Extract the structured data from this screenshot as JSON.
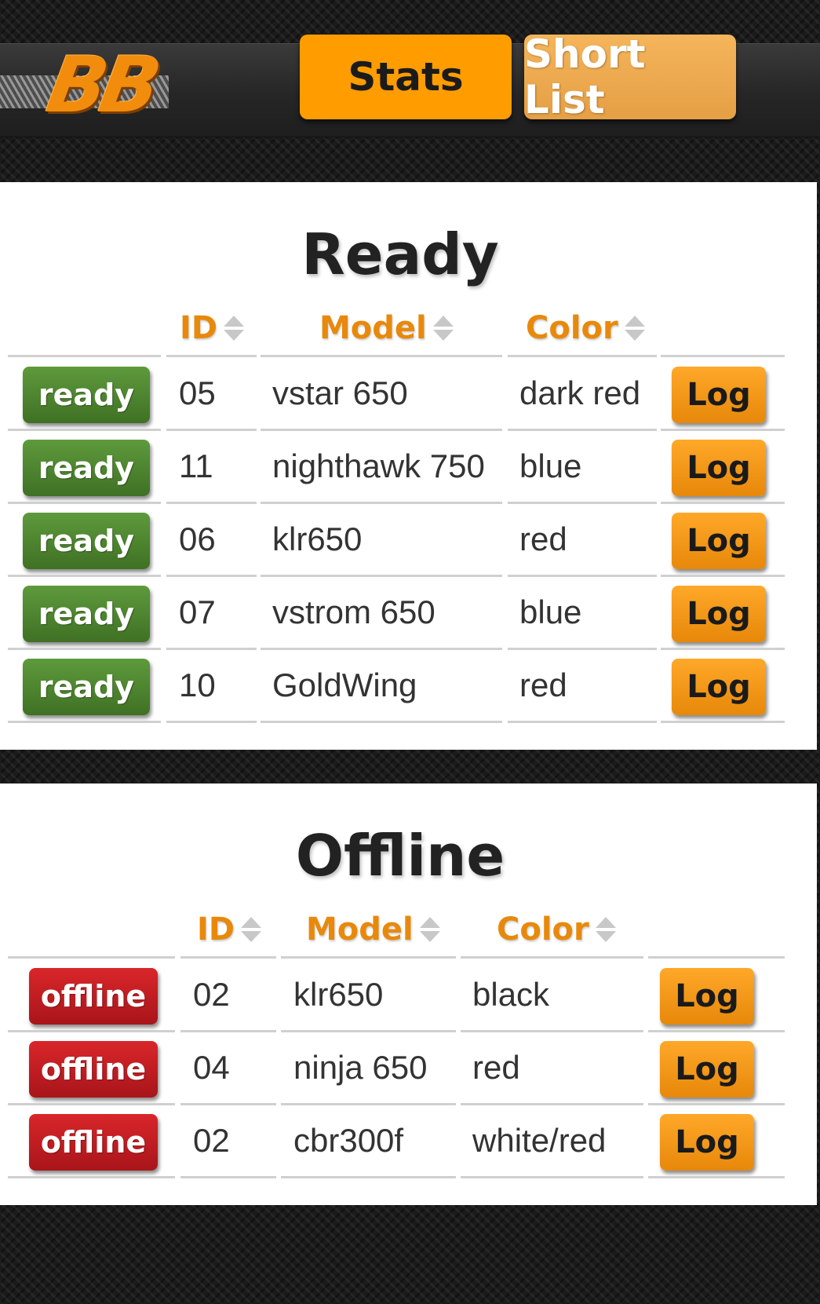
{
  "header": {
    "logo_text": "BB",
    "nav": [
      {
        "label": "Stats"
      },
      {
        "label": "Short List"
      }
    ]
  },
  "ready": {
    "title": "Ready",
    "columns": [
      "ID",
      "Model",
      "Color"
    ],
    "rows": [
      {
        "status": "ready",
        "id": "05",
        "model": "vstar 650",
        "color": "dark red",
        "action": "Log"
      },
      {
        "status": "ready",
        "id": "11",
        "model": "nighthawk 750",
        "color": "blue",
        "action": "Log"
      },
      {
        "status": "ready",
        "id": "06",
        "model": "klr650",
        "color": "red",
        "action": "Log"
      },
      {
        "status": "ready",
        "id": "07",
        "model": "vstrom 650",
        "color": "blue",
        "action": "Log"
      },
      {
        "status": "ready",
        "id": "10",
        "model": "GoldWing",
        "color": "red",
        "action": "Log"
      }
    ]
  },
  "offline": {
    "title": "Offline",
    "columns": [
      "ID",
      "Model",
      "Color"
    ],
    "rows": [
      {
        "status": "offline",
        "id": "02",
        "model": "klr650",
        "color": "black",
        "action": "Log"
      },
      {
        "status": "offline",
        "id": "04",
        "model": "ninja 650",
        "color": "red",
        "action": "Log"
      },
      {
        "status": "offline",
        "id": "02",
        "model": "cbr300f",
        "color": "white/red",
        "action": "Log"
      }
    ]
  },
  "colors": {
    "accent": "#ff9c00",
    "ready": "#4f8530",
    "offline": "#c41e22",
    "header_text": "#e8890c"
  },
  "icons": {
    "sort": "sort-both-icon"
  }
}
